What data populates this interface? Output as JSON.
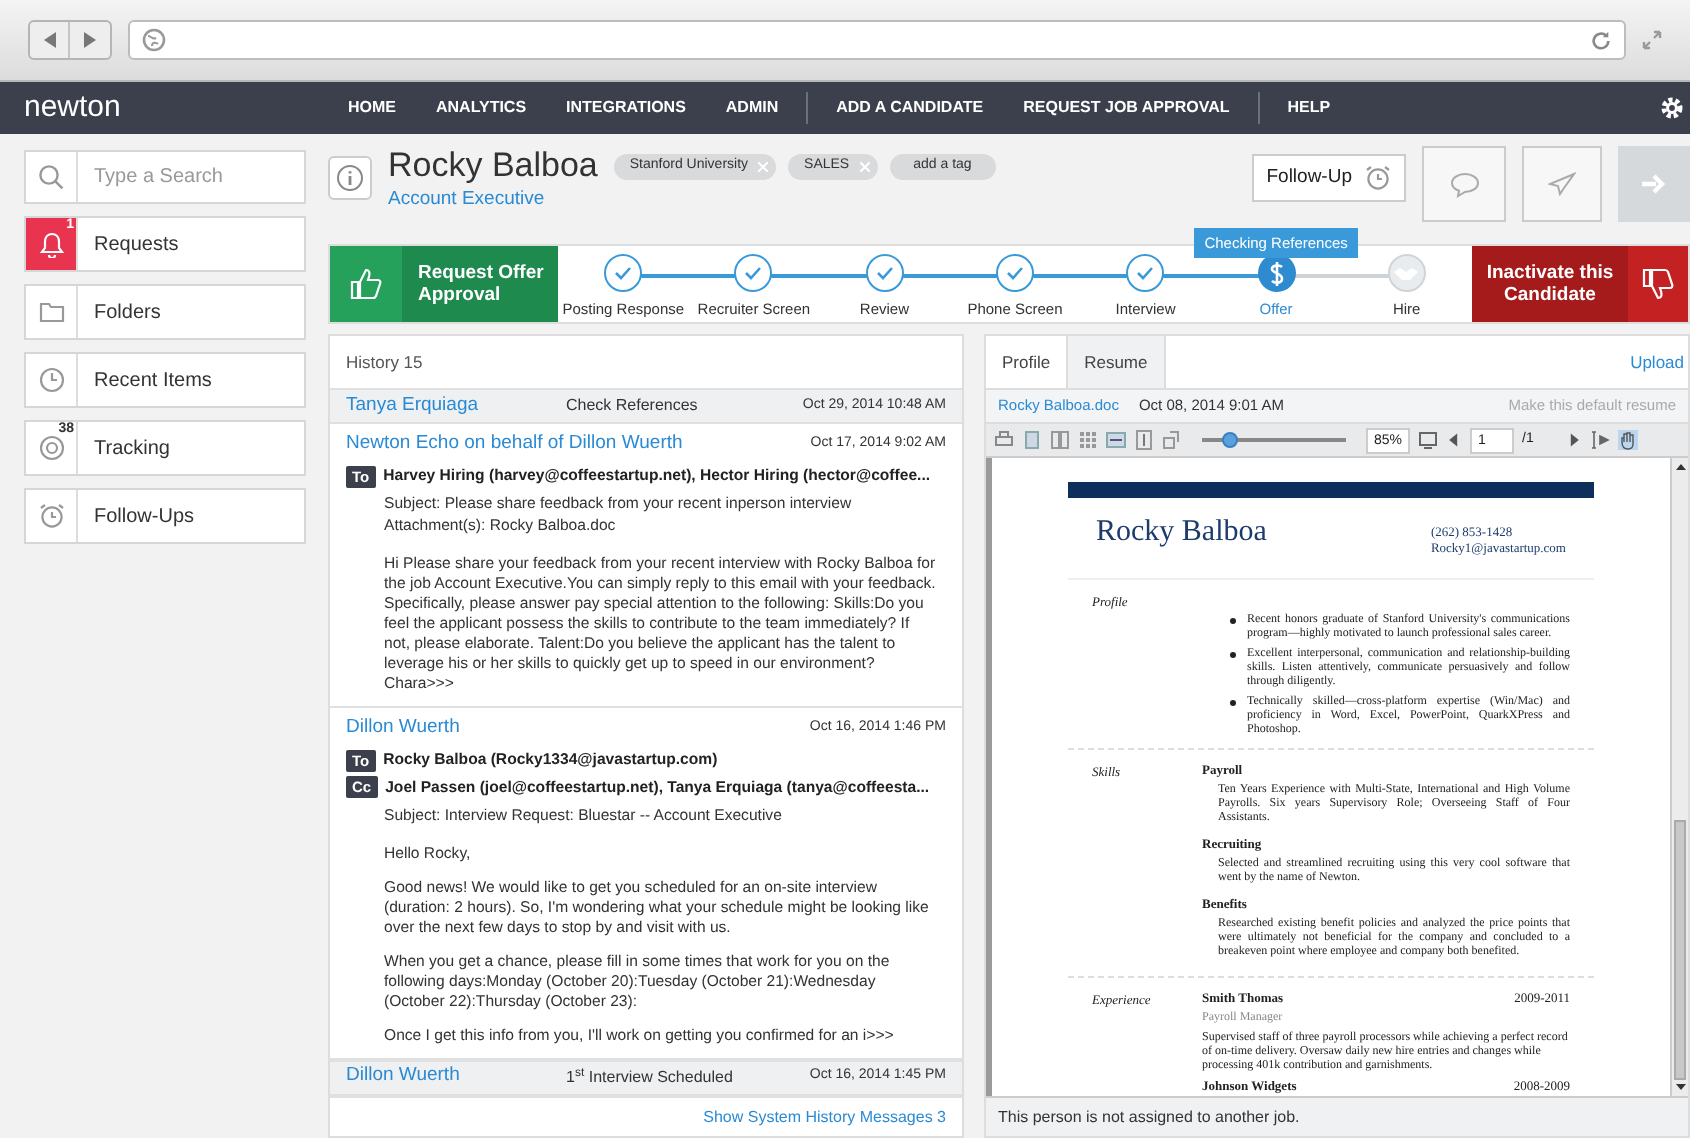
{
  "nav": {
    "logo": "newton",
    "items": [
      {
        "label": "HOME",
        "separator_before": false
      },
      {
        "label": "ANALYTICS",
        "separator_before": false
      },
      {
        "label": "INTEGRATIONS",
        "separator_before": false
      },
      {
        "label": "ADMIN",
        "separator_before": false
      },
      {
        "label": "ADD A CANDIDATE",
        "separator_before": true
      },
      {
        "label": "REQUEST JOB APPROVAL",
        "separator_before": false
      },
      {
        "label": "HELP",
        "separator_before": true
      }
    ]
  },
  "sidebar": {
    "search": {
      "placeholder": "Type a Search"
    },
    "items": [
      {
        "label": "Requests",
        "kind": "bell",
        "badge": "1",
        "highlight": true
      },
      {
        "label": "Folders",
        "kind": "folder",
        "highlight": false
      },
      {
        "label": "Recent Items",
        "kind": "clock",
        "highlight": false
      },
      {
        "label": "Tracking",
        "kind": "target",
        "badge": "38",
        "highlight": false
      },
      {
        "label": "Follow-Ups",
        "kind": "alarm",
        "highlight": false
      }
    ]
  },
  "candidate": {
    "name": "Rocky Balboa",
    "title": "Account Executive",
    "tags": [
      {
        "label": "Stanford University",
        "kind": "tag"
      },
      {
        "label": "SALES",
        "kind": "tag"
      },
      {
        "label": "add a tag",
        "kind": "add"
      }
    ],
    "follow_up": "Follow-Up"
  },
  "pipeline": {
    "approve": "Request Offer Approval",
    "inactivate": "Inactivate this Candidate",
    "tooltip": "Checking References",
    "steps": [
      {
        "label": "Posting Response",
        "done": true,
        "selected": false
      },
      {
        "label": "Recruiter Screen",
        "done": true,
        "selected": false
      },
      {
        "label": "Review",
        "done": true,
        "selected": false
      },
      {
        "label": "Phone Screen",
        "done": true,
        "selected": false
      },
      {
        "label": "Interview",
        "done": true,
        "selected": false
      },
      {
        "label": "Offer",
        "done": false,
        "selected": true
      },
      {
        "label": "Hire",
        "done": false,
        "selected": false
      }
    ]
  },
  "history": {
    "title": "History 15",
    "rows": [
      {
        "kind": "event",
        "who": "Tanya Erquiaga",
        "what": "Check References",
        "date": "Oct 29, 2014 10:48 AM"
      },
      {
        "kind": "email",
        "who": "Newton Echo on behalf of Dillon Wuerth",
        "date": "Oct 17, 2014 9:02 AM",
        "recipients": [
          {
            "kind": "To",
            "text": "Harvey Hiring (harvey@coffeestartup.net), Hector Hiring (hector@coffee..."
          }
        ],
        "lines": [
          "Subject: Please share feedback from your recent inperson interview",
          "Attachment(s): Rocky Balboa.doc"
        ],
        "body": [
          "Hi  Please share your feedback from your recent interview with Rocky Balboa for the job Account Executive.You can simply reply to this email with your feedback. Specifically, please answer pay special attention to the following: Skills:Do you feel the applicant possess the skills to contribute to the team immediately? If not, please elaborate. Talent:Do you believe the applicant has the talent to leverage his or her skills to quickly get up to speed in our environment?  Chara>>>"
        ]
      },
      {
        "kind": "email",
        "who": "Dillon Wuerth",
        "date": "Oct 16, 2014 1:46 PM",
        "recipients": [
          {
            "kind": "To",
            "text": "Rocky Balboa (Rocky1334@javastartup.com)"
          },
          {
            "kind": "Cc",
            "text": "Joel Passen (joel@coffeestartup.net), Tanya Erquiaga (tanya@coffeesta..."
          }
        ],
        "lines": [
          "Subject: Interview Request: Bluestar -- Account Executive"
        ],
        "body": [
          "Hello Rocky,",
          "Good news! We would like to get you scheduled for an on-site interview (duration: 2 hours). So, I'm wondering what your schedule might be looking like over the next few days to stop by and visit with us.",
          "When you get a chance, please fill in some times that work for you on the following days:Monday (October 20):Tuesday (October 21):Wednesday (October 22):Thursday (October 23):",
          "Once I get this info from you, I'll work on getting you confirmed for an i>>>"
        ]
      },
      {
        "kind": "event",
        "who": "Dillon Wuerth",
        "what": "1$^{st}$ Interview Scheduled",
        "date": "Oct 16, 2014 1:45 PM"
      }
    ],
    "footer_link": "Show System History Messages 3"
  },
  "resume_panel": {
    "tabs": [
      {
        "label": "Profile",
        "selected": false
      },
      {
        "label": "Resume",
        "selected": true
      }
    ],
    "upload": "Upload",
    "file": "Rocky Balboa.doc",
    "date": "Oct 08, 2014 9:01 AM",
    "make_default": "Make this default resume",
    "zoom": {
      "level": 0.2,
      "value": "85%"
    },
    "page": "1",
    "pages": "/1",
    "footer": "This person is not assigned to another job."
  },
  "resume": {
    "name": "Rocky Balboa",
    "phone": "(262) 853-1428",
    "email": "Rocky1@javastartup.com",
    "sections": [
      {
        "heading": "Profile",
        "kind": "bullets",
        "bullets": [
          "Recent honors graduate of Stanford University's communications program—highly motivated to launch professional sales career.",
          "Excellent interpersonal, communication and relationship-building skills. Listen attentively, communicate persuasively and follow through diligently.",
          "Technically skilled—cross-platform expertise (Win/Mac) and proficiency in Word, Excel, PowerPoint, QuarkXPress and Photoshop."
        ]
      },
      {
        "heading": "Skills",
        "kind": "skills",
        "items": [
          {
            "title": "Payroll",
            "text": "Ten Years Experience with Multi-State, International and High Volume Payrolls. Six years Supervisory Role; Overseeing Staff of Four Assistants."
          },
          {
            "title": "Recruiting",
            "text": "Selected and streamlined recruiting using this very cool software that went by the name of Newton."
          },
          {
            "title": "Benefits",
            "text": "Researched existing benefit policies and analyzed the price points that were ultimately not beneficial for the company and concluded to a breakeven point where employee and company both benefited."
          }
        ]
      },
      {
        "heading": "Experience",
        "kind": "jobs",
        "jobs": [
          {
            "company": "Smith Thomas",
            "years": "2009-2011",
            "role": "Payroll Manager",
            "text": "Supervised staff of three payroll processors while achieving a perfect record of on-time delivery. Oversaw daily new hire entries and changes while processing 401k contribution and garnishments."
          },
          {
            "company": "Johnson Widgets",
            "years": "2008-2009"
          }
        ]
      }
    ]
  }
}
